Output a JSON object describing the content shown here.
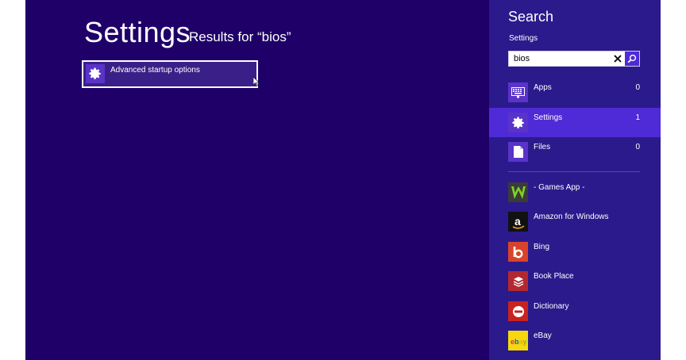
{
  "results": {
    "title": "Settings",
    "subtitle": "Results for “bios”",
    "items": [
      {
        "label": "Advanced startup options",
        "icon": "gear-icon"
      }
    ]
  },
  "charm": {
    "title": "Search",
    "scope": "Settings",
    "search_value": "bios",
    "categories": [
      {
        "label": "Apps",
        "count": "0",
        "icon": "keyboard-icon"
      },
      {
        "label": "Settings",
        "count": "1",
        "icon": "gear-icon",
        "selected": true
      },
      {
        "label": "Files",
        "count": "0",
        "icon": "file-icon"
      }
    ],
    "apps": [
      {
        "label": "- Games App -",
        "icon": "games-app-icon",
        "color": "#3b3b3b"
      },
      {
        "label": "Amazon for Windows",
        "icon": "amazon-icon",
        "color": "#111111"
      },
      {
        "label": "Bing",
        "icon": "bing-icon",
        "color": "#d9432a"
      },
      {
        "label": "Book Place",
        "icon": "book-place-icon",
        "color": "#b3282f"
      },
      {
        "label": "Dictionary",
        "icon": "dictionary-icon",
        "color": "#c8231f"
      },
      {
        "label": "eBay",
        "icon": "ebay-icon",
        "color": "#f5d80e"
      }
    ]
  },
  "colors": {
    "background": "#1f0068",
    "charm_background": "#2b1a8c",
    "accent": "#4e2bd6"
  }
}
